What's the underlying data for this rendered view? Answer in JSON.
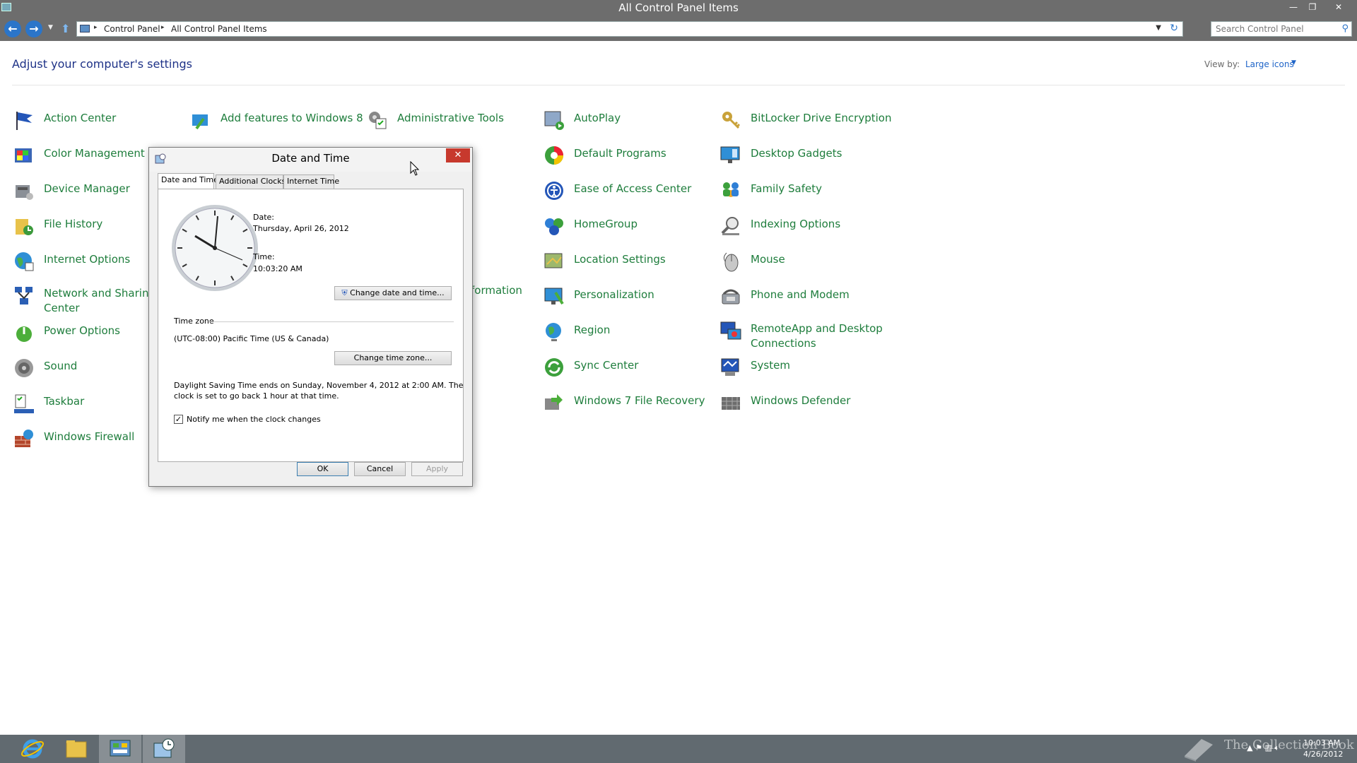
{
  "window": {
    "title": "All Control Panel Items",
    "minimize": "—",
    "restore": "❐",
    "close": "✕"
  },
  "address_bar": {
    "back_icon": "←",
    "forward_icon": "→",
    "crumbs": [
      "Control Panel",
      "All Control Panel Items"
    ],
    "separator": "▸",
    "search_placeholder": "Search Control Panel"
  },
  "header": {
    "heading": "Adjust your computer's settings",
    "view_by_label": "View by:",
    "view_by_value": "Large icons"
  },
  "items": [
    {
      "label": "Action Center"
    },
    {
      "label": "Color Management"
    },
    {
      "label": "Device Manager"
    },
    {
      "label": "File History"
    },
    {
      "label": "Internet Options"
    },
    {
      "label": "Network and Sharing Center"
    },
    {
      "label": "Power Options"
    },
    {
      "label": "Sound"
    },
    {
      "label": "Taskbar"
    },
    {
      "label": "Windows Firewall"
    },
    {
      "label": "Add features to Windows 8"
    },
    {
      "label": "Administrative Tools"
    },
    {
      "label": "formation"
    },
    {
      "label": "AutoPlay"
    },
    {
      "label": "Default Programs"
    },
    {
      "label": "Ease of Access Center"
    },
    {
      "label": "HomeGroup"
    },
    {
      "label": "Location Settings"
    },
    {
      "label": "Personalization"
    },
    {
      "label": "Region"
    },
    {
      "label": "Sync Center"
    },
    {
      "label": "Windows 7 File Recovery"
    },
    {
      "label": "BitLocker Drive Encryption"
    },
    {
      "label": "Desktop Gadgets"
    },
    {
      "label": "Family Safety"
    },
    {
      "label": "Indexing Options"
    },
    {
      "label": "Mouse"
    },
    {
      "label": "Phone and Modem"
    },
    {
      "label": "RemoteApp and Desktop Connections"
    },
    {
      "label": "System"
    },
    {
      "label": "Windows Defender"
    }
  ],
  "dialog": {
    "title": "Date and Time",
    "close": "✕",
    "tabs": [
      "Date and Time",
      "Additional Clocks",
      "Internet Time"
    ],
    "date_label": "Date:",
    "date_value": "Thursday, April 26, 2012",
    "time_label": "Time:",
    "time_value": "10:03:20 AM",
    "change_date_button": "Change date and time...",
    "time_zone_heading": "Time zone",
    "time_zone_value": "(UTC-08:00) Pacific Time (US & Canada)",
    "change_zone_button": "Change time zone...",
    "dst_line1": "Daylight Saving Time ends on Sunday, November 4, 2012 at 2:00 AM. The",
    "dst_line2": "clock is set to go back 1 hour at that time.",
    "notify_label": "Notify me when the clock changes",
    "notify_checked": "✓",
    "ok": "OK",
    "cancel": "Cancel",
    "apply": "Apply"
  },
  "taskbar": {
    "apps": [
      "internet-explorer",
      "file-explorer",
      "control-panel",
      "date-time"
    ],
    "time": "10:03 AM",
    "date": "4/26/2012",
    "watermark": "The Collection Book"
  }
}
